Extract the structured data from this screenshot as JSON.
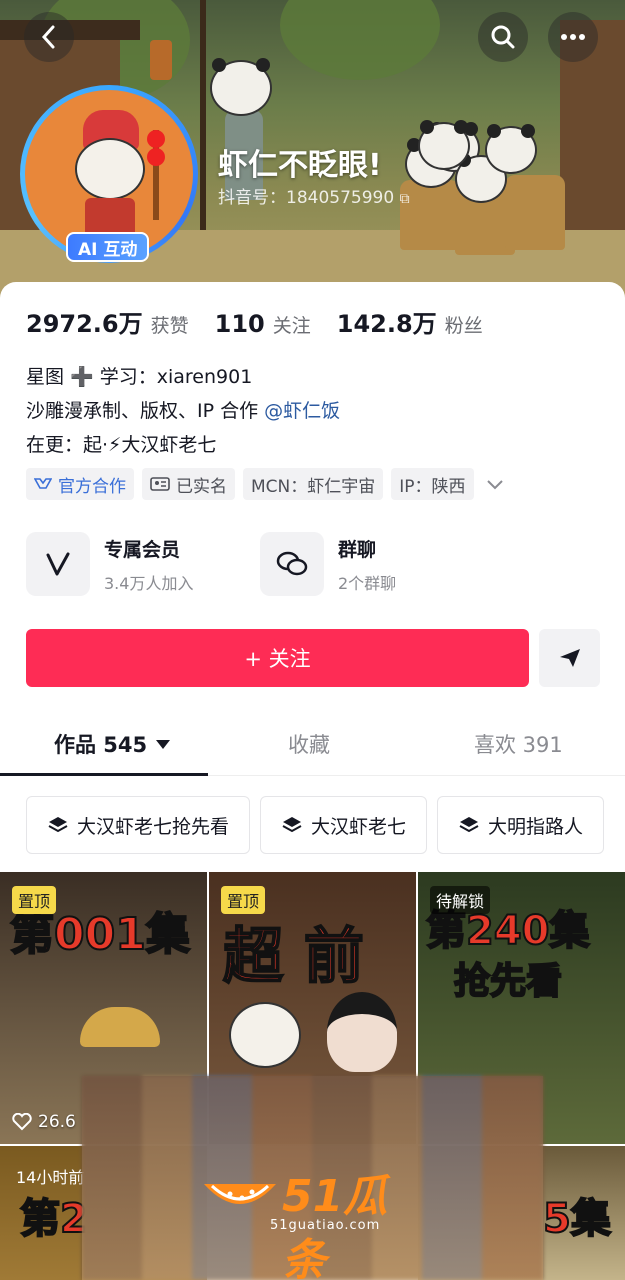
{
  "profile": {
    "name": "虾仁不眨眼!",
    "id_label": "抖音号：1840575990",
    "ai_badge": "AI 互动"
  },
  "stats": [
    {
      "value": "2972.6万",
      "label": "获赞"
    },
    {
      "value": "110",
      "label": "关注"
    },
    {
      "value": "142.8万",
      "label": "粉丝"
    }
  ],
  "bio": {
    "line1": "星图 ➕ 学习：xiaren901",
    "line2_prefix": "沙雕漫承制、版权、IP 合作",
    "line2_mention": "@虾仁饭",
    "line3": "在更：起·⚡大汉虾老七"
  },
  "tags": [
    "官方合作",
    "已实名",
    "MCN：虾仁宇宙",
    "IP：陕西"
  ],
  "features": [
    {
      "title": "专属会员",
      "sub": "3.4万人加入",
      "icon": "vip-v-icon"
    },
    {
      "title": "群聊",
      "sub": "2个群聊",
      "icon": "chat-bubbles-icon"
    }
  ],
  "follow_label": "+ 关注",
  "tabs": [
    {
      "label": "作品 545"
    },
    {
      "label": "收藏"
    },
    {
      "label": "喜欢 391"
    }
  ],
  "collections": [
    "大汉虾老七抢先看",
    "大汉虾老七",
    "大明指路人"
  ],
  "videos": [
    {
      "chip": "置顶",
      "big": "第001集",
      "likes": "26.6"
    },
    {
      "chip": "置顶",
      "big": "超 前"
    },
    {
      "chip": "待解锁",
      "big": "第240集",
      "big2": "抢先看"
    },
    {
      "time": "14小时前",
      "big": "第2"
    },
    {
      "big": "5集"
    }
  ],
  "watermark": {
    "brand": "51瓜条",
    "url": "51guatiao.com"
  },
  "colors": {
    "accent": "#fe2c55",
    "mention": "#2c5aa0"
  }
}
